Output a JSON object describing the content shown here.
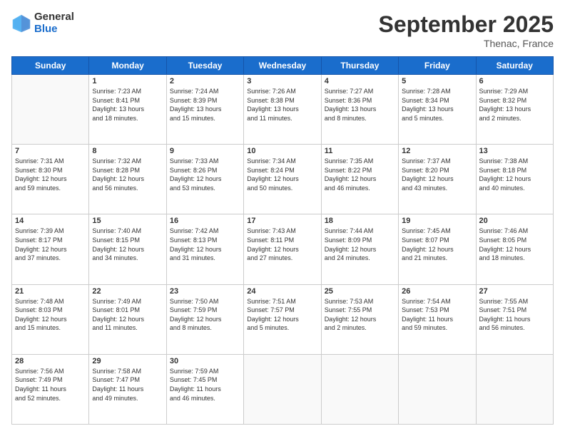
{
  "logo": {
    "general": "General",
    "blue": "Blue"
  },
  "header": {
    "month": "September 2025",
    "location": "Thenac, France"
  },
  "weekdays": [
    "Sunday",
    "Monday",
    "Tuesday",
    "Wednesday",
    "Thursday",
    "Friday",
    "Saturday"
  ],
  "weeks": [
    [
      {
        "day": "",
        "info": ""
      },
      {
        "day": "1",
        "info": "Sunrise: 7:23 AM\nSunset: 8:41 PM\nDaylight: 13 hours\nand 18 minutes."
      },
      {
        "day": "2",
        "info": "Sunrise: 7:24 AM\nSunset: 8:39 PM\nDaylight: 13 hours\nand 15 minutes."
      },
      {
        "day": "3",
        "info": "Sunrise: 7:26 AM\nSunset: 8:38 PM\nDaylight: 13 hours\nand 11 minutes."
      },
      {
        "day": "4",
        "info": "Sunrise: 7:27 AM\nSunset: 8:36 PM\nDaylight: 13 hours\nand 8 minutes."
      },
      {
        "day": "5",
        "info": "Sunrise: 7:28 AM\nSunset: 8:34 PM\nDaylight: 13 hours\nand 5 minutes."
      },
      {
        "day": "6",
        "info": "Sunrise: 7:29 AM\nSunset: 8:32 PM\nDaylight: 13 hours\nand 2 minutes."
      }
    ],
    [
      {
        "day": "7",
        "info": "Sunrise: 7:31 AM\nSunset: 8:30 PM\nDaylight: 12 hours\nand 59 minutes."
      },
      {
        "day": "8",
        "info": "Sunrise: 7:32 AM\nSunset: 8:28 PM\nDaylight: 12 hours\nand 56 minutes."
      },
      {
        "day": "9",
        "info": "Sunrise: 7:33 AM\nSunset: 8:26 PM\nDaylight: 12 hours\nand 53 minutes."
      },
      {
        "day": "10",
        "info": "Sunrise: 7:34 AM\nSunset: 8:24 PM\nDaylight: 12 hours\nand 50 minutes."
      },
      {
        "day": "11",
        "info": "Sunrise: 7:35 AM\nSunset: 8:22 PM\nDaylight: 12 hours\nand 46 minutes."
      },
      {
        "day": "12",
        "info": "Sunrise: 7:37 AM\nSunset: 8:20 PM\nDaylight: 12 hours\nand 43 minutes."
      },
      {
        "day": "13",
        "info": "Sunrise: 7:38 AM\nSunset: 8:18 PM\nDaylight: 12 hours\nand 40 minutes."
      }
    ],
    [
      {
        "day": "14",
        "info": "Sunrise: 7:39 AM\nSunset: 8:17 PM\nDaylight: 12 hours\nand 37 minutes."
      },
      {
        "day": "15",
        "info": "Sunrise: 7:40 AM\nSunset: 8:15 PM\nDaylight: 12 hours\nand 34 minutes."
      },
      {
        "day": "16",
        "info": "Sunrise: 7:42 AM\nSunset: 8:13 PM\nDaylight: 12 hours\nand 31 minutes."
      },
      {
        "day": "17",
        "info": "Sunrise: 7:43 AM\nSunset: 8:11 PM\nDaylight: 12 hours\nand 27 minutes."
      },
      {
        "day": "18",
        "info": "Sunrise: 7:44 AM\nSunset: 8:09 PM\nDaylight: 12 hours\nand 24 minutes."
      },
      {
        "day": "19",
        "info": "Sunrise: 7:45 AM\nSunset: 8:07 PM\nDaylight: 12 hours\nand 21 minutes."
      },
      {
        "day": "20",
        "info": "Sunrise: 7:46 AM\nSunset: 8:05 PM\nDaylight: 12 hours\nand 18 minutes."
      }
    ],
    [
      {
        "day": "21",
        "info": "Sunrise: 7:48 AM\nSunset: 8:03 PM\nDaylight: 12 hours\nand 15 minutes."
      },
      {
        "day": "22",
        "info": "Sunrise: 7:49 AM\nSunset: 8:01 PM\nDaylight: 12 hours\nand 11 minutes."
      },
      {
        "day": "23",
        "info": "Sunrise: 7:50 AM\nSunset: 7:59 PM\nDaylight: 12 hours\nand 8 minutes."
      },
      {
        "day": "24",
        "info": "Sunrise: 7:51 AM\nSunset: 7:57 PM\nDaylight: 12 hours\nand 5 minutes."
      },
      {
        "day": "25",
        "info": "Sunrise: 7:53 AM\nSunset: 7:55 PM\nDaylight: 12 hours\nand 2 minutes."
      },
      {
        "day": "26",
        "info": "Sunrise: 7:54 AM\nSunset: 7:53 PM\nDaylight: 11 hours\nand 59 minutes."
      },
      {
        "day": "27",
        "info": "Sunrise: 7:55 AM\nSunset: 7:51 PM\nDaylight: 11 hours\nand 56 minutes."
      }
    ],
    [
      {
        "day": "28",
        "info": "Sunrise: 7:56 AM\nSunset: 7:49 PM\nDaylight: 11 hours\nand 52 minutes."
      },
      {
        "day": "29",
        "info": "Sunrise: 7:58 AM\nSunset: 7:47 PM\nDaylight: 11 hours\nand 49 minutes."
      },
      {
        "day": "30",
        "info": "Sunrise: 7:59 AM\nSunset: 7:45 PM\nDaylight: 11 hours\nand 46 minutes."
      },
      {
        "day": "",
        "info": ""
      },
      {
        "day": "",
        "info": ""
      },
      {
        "day": "",
        "info": ""
      },
      {
        "day": "",
        "info": ""
      }
    ]
  ]
}
